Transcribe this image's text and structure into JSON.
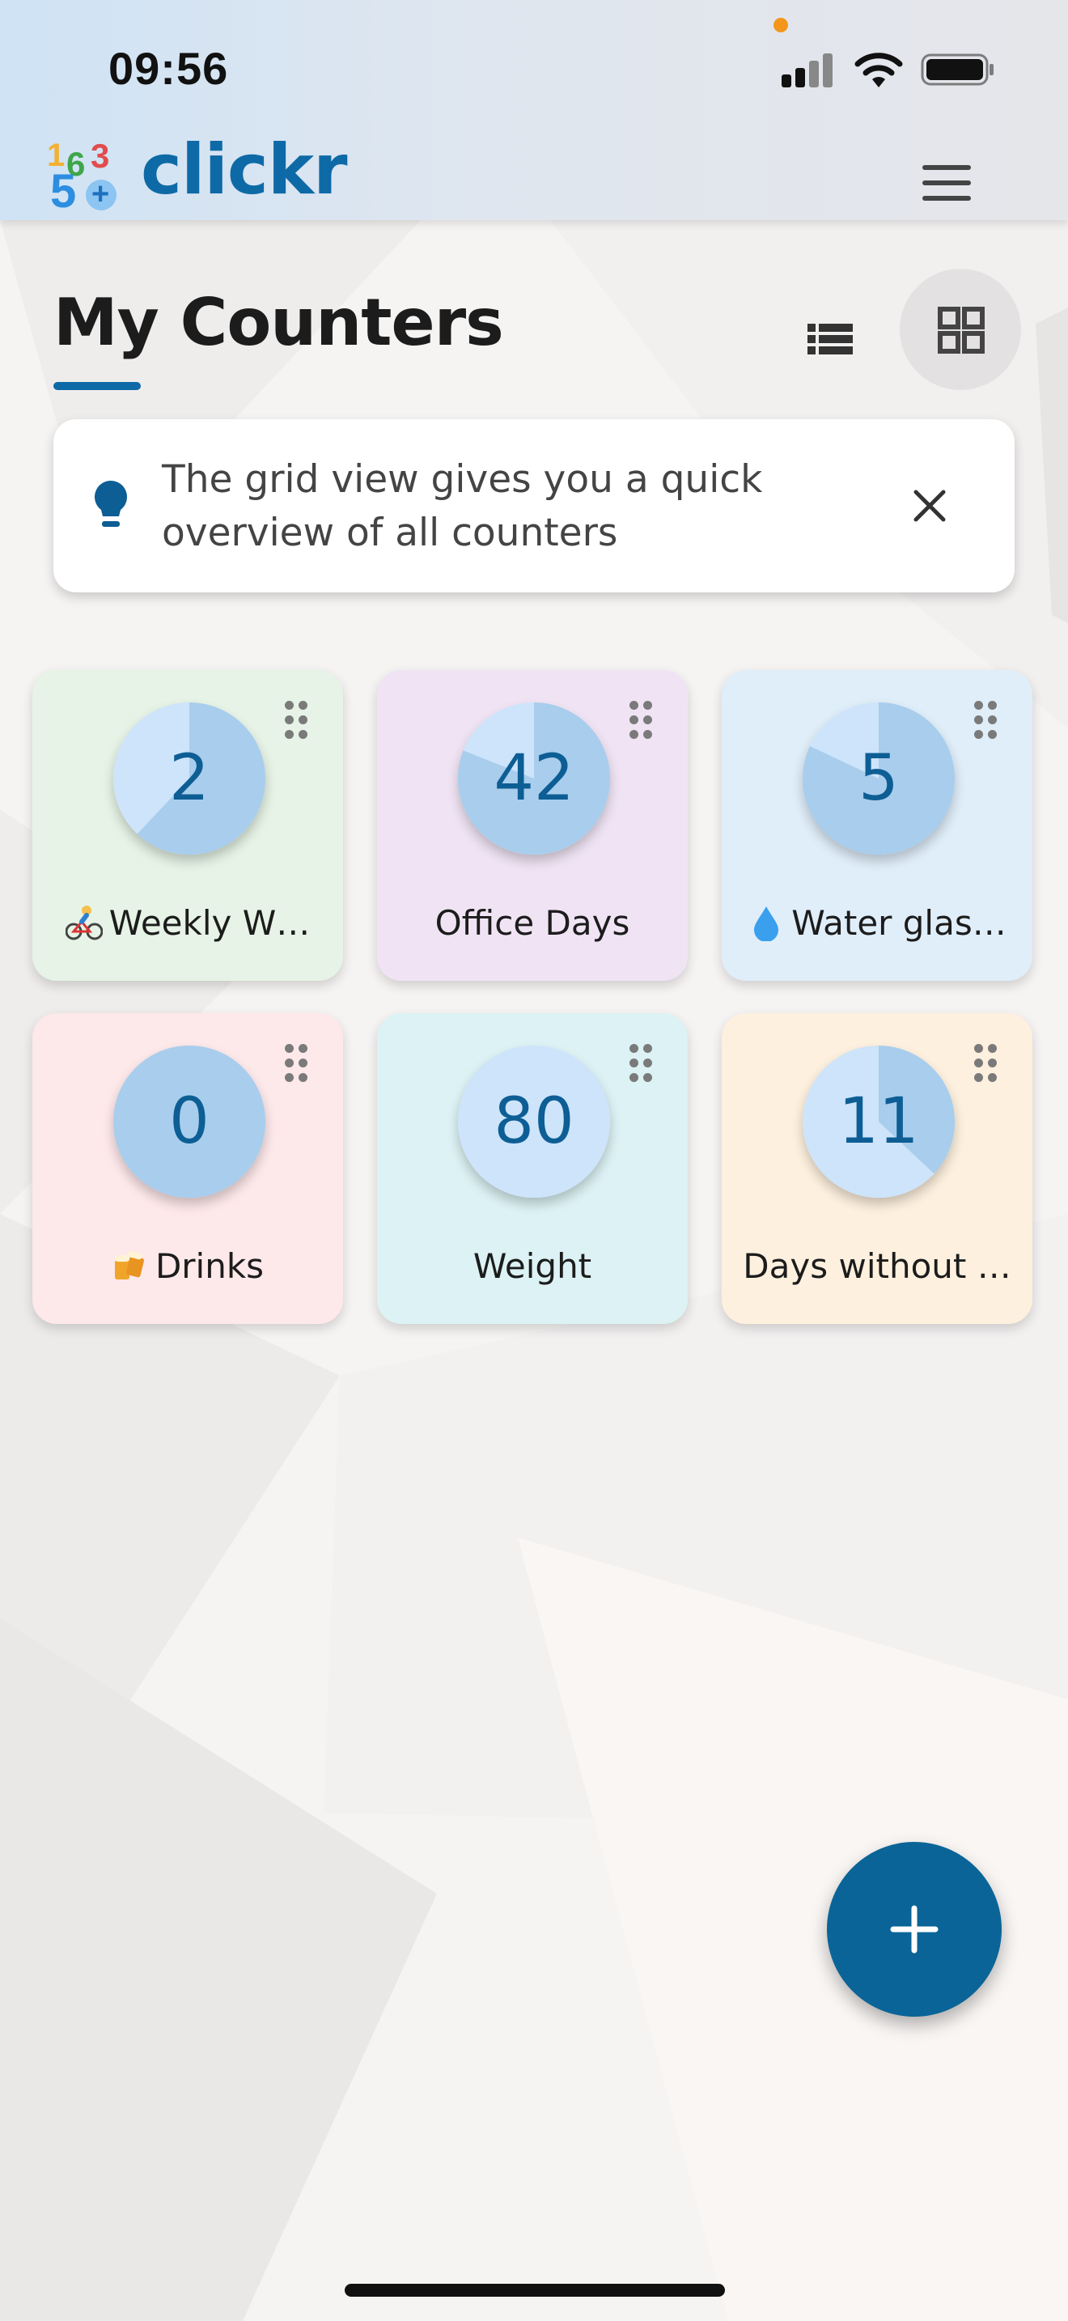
{
  "status_bar": {
    "time": "09:56",
    "colors": {
      "privacy_dot": "#f3961b"
    }
  },
  "app_bar": {
    "brand": "clickr",
    "logo_digits": [
      "1",
      "6",
      "3",
      "5",
      "+"
    ],
    "menu_icon": "hamburger-menu-icon"
  },
  "page": {
    "title": "My Counters",
    "view_toggle": {
      "list_icon": "list-view-icon",
      "grid_icon": "grid-view-icon",
      "selected": "grid"
    }
  },
  "tip": {
    "icon": "lightbulb-icon",
    "text": "The grid view gives you a quick overview of all counters",
    "close_icon": "close-icon"
  },
  "counters": [
    {
      "value": "2",
      "label": "Weekly W…",
      "emoji": "cyclist",
      "progress": 0.62,
      "bg": "#e6f3e6"
    },
    {
      "value": "42",
      "label": "Office Days",
      "emoji": "",
      "progress": 0.81,
      "bg": "#f0e4f4"
    },
    {
      "value": "5",
      "label": "Water glas…",
      "emoji": "droplet",
      "progress": 0.82,
      "bg": "#e0eefa"
    },
    {
      "value": "0",
      "label": "Drinks",
      "emoji": "beer-mugs",
      "progress": 1.0,
      "bg": "#fde8ea"
    },
    {
      "value": "80",
      "label": "Weight",
      "emoji": "",
      "progress": 0.0,
      "bg": "#dcf2f4"
    },
    {
      "value": "11",
      "label": "Days without …",
      "emoji": "",
      "progress": 0.37,
      "bg": "#fdf0de"
    }
  ],
  "fab": {
    "icon": "plus-icon"
  },
  "colors": {
    "brand": "#0e6aa6",
    "counter_text": "#0d5e94",
    "circle_light": "#cde4fa",
    "circle_fill": "#a9cdec",
    "fab": "#0a6497"
  }
}
